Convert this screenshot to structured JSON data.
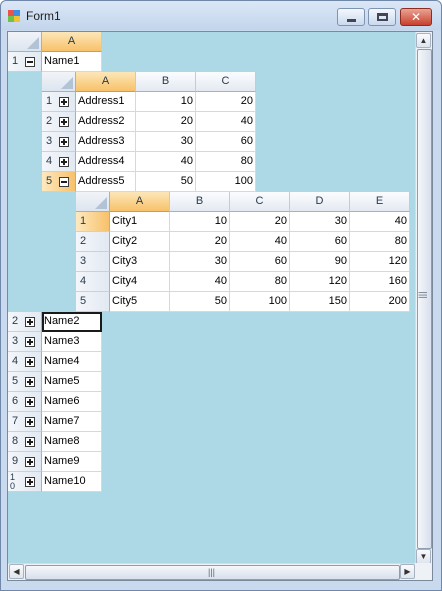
{
  "window": {
    "title": "Form1",
    "close_glyph": "✕"
  },
  "level1": {
    "column": "A",
    "rows": [
      {
        "num": "1",
        "name": "Name1",
        "expanded": true
      },
      {
        "num": "2",
        "name": "Name2",
        "expanded": false,
        "selected": true
      },
      {
        "num": "3",
        "name": "Name3",
        "expanded": false
      },
      {
        "num": "4",
        "name": "Name4",
        "expanded": false
      },
      {
        "num": "5",
        "name": "Name5",
        "expanded": false
      },
      {
        "num": "6",
        "name": "Name6",
        "expanded": false
      },
      {
        "num": "7",
        "name": "Name7",
        "expanded": false
      },
      {
        "num": "8",
        "name": "Name8",
        "expanded": false
      },
      {
        "num": "9",
        "name": "Name9",
        "expanded": false
      },
      {
        "num": "10",
        "name": "Name10",
        "expanded": false
      }
    ]
  },
  "level2": {
    "columns": [
      "A",
      "B",
      "C"
    ],
    "rows": [
      {
        "num": "1",
        "cells": [
          "Address1",
          "10",
          "20"
        ],
        "expanded": false
      },
      {
        "num": "2",
        "cells": [
          "Address2",
          "20",
          "40"
        ],
        "expanded": false
      },
      {
        "num": "3",
        "cells": [
          "Address3",
          "30",
          "60"
        ],
        "expanded": false
      },
      {
        "num": "4",
        "cells": [
          "Address4",
          "40",
          "80"
        ],
        "expanded": false
      },
      {
        "num": "5",
        "cells": [
          "Address5",
          "50",
          "100"
        ],
        "expanded": true,
        "active": true
      }
    ]
  },
  "level3": {
    "columns": [
      "A",
      "B",
      "C",
      "D",
      "E"
    ],
    "rows": [
      {
        "num": "1",
        "cells": [
          "City1",
          "10",
          "20",
          "30",
          "40"
        ],
        "active": true
      },
      {
        "num": "2",
        "cells": [
          "City2",
          "20",
          "40",
          "60",
          "80"
        ]
      },
      {
        "num": "3",
        "cells": [
          "City3",
          "30",
          "60",
          "90",
          "120"
        ]
      },
      {
        "num": "4",
        "cells": [
          "City4",
          "40",
          "80",
          "120",
          "160"
        ]
      },
      {
        "num": "5",
        "cells": [
          "City5",
          "50",
          "100",
          "150",
          "200"
        ]
      }
    ]
  },
  "icons": {
    "expander_open": "minus-icon",
    "expander_closed": "plus-icon",
    "scroll_up": "▲",
    "scroll_down": "▼",
    "scroll_left": "◀",
    "scroll_right": "▶",
    "grip": "|||"
  }
}
